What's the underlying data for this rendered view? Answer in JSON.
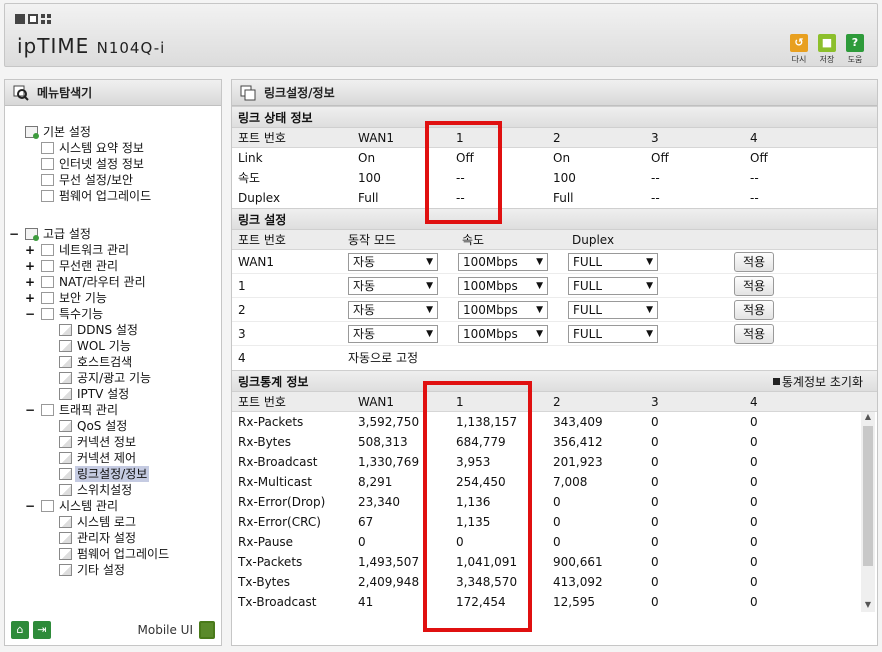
{
  "header": {
    "brand_main": "ipTIME",
    "brand_model": "N104Q-i",
    "buttons": [
      {
        "label": "다시",
        "icon": "undo-icon",
        "color": "#e8a020",
        "glyph": "↺"
      },
      {
        "label": "저장",
        "icon": "save-icon",
        "color": "#8cbf2c",
        "glyph": "■"
      },
      {
        "label": "도움",
        "icon": "help-icon",
        "color": "#2e9b3a",
        "glyph": "?"
      }
    ]
  },
  "sidebar": {
    "title": "메뉴탐색기",
    "basic_group": "기본 설정",
    "basic_items": [
      "시스템 요약 정보",
      "인터넷 설정 정보",
      "무선 설정/보안",
      "펌웨어 업그레이드"
    ],
    "advanced_group": "고급 설정",
    "advanced_items": [
      "네트워크 관리",
      "무선랜 관리",
      "NAT/라우터 관리",
      "보안 기능",
      "특수기능"
    ],
    "special_items": [
      "DDNS 설정",
      "WOL 기능",
      "호스트검색",
      "공지/광고 기능",
      "IPTV 설정"
    ],
    "traffic_group": "트래픽 관리",
    "traffic_items": [
      "QoS 설정",
      "커넥션 정보",
      "커넥션 제어",
      "링크설정/정보",
      "스위치설정"
    ],
    "system_group": "시스템 관리",
    "system_items": [
      "시스템 로그",
      "관리자 설정",
      "펌웨어 업그레이드",
      "기타 설정"
    ],
    "selected": "링크설정/정보",
    "mobile_label": "Mobile UI"
  },
  "main": {
    "title": "링크설정/정보",
    "link_status": {
      "title": "링크 상태 정보",
      "headers": [
        "포트 번호",
        "WAN1",
        "1",
        "2",
        "3",
        "4"
      ],
      "rows": [
        [
          "Link",
          "On",
          "Off",
          "On",
          "Off",
          "Off"
        ],
        [
          "속도",
          "100",
          "--",
          "100",
          "--",
          "--"
        ],
        [
          "Duplex",
          "Full",
          "--",
          "Full",
          "--",
          "--"
        ]
      ]
    },
    "link_config": {
      "title": "링크 설정",
      "headers": [
        "포트 번호",
        "동작 모드",
        "속도",
        "Duplex"
      ],
      "rows": [
        {
          "port": "WAN1",
          "mode": "자동",
          "speed": "100Mbps",
          "duplex": "FULL",
          "apply": "적용"
        },
        {
          "port": "1",
          "mode": "자동",
          "speed": "100Mbps",
          "duplex": "FULL",
          "apply": "적용"
        },
        {
          "port": "2",
          "mode": "자동",
          "speed": "100Mbps",
          "duplex": "FULL",
          "apply": "적용"
        },
        {
          "port": "3",
          "mode": "자동",
          "speed": "100Mbps",
          "duplex": "FULL",
          "apply": "적용"
        }
      ],
      "fixed_row": {
        "port": "4",
        "note": "자동으로 고정"
      }
    },
    "link_stats": {
      "title": "링크통계 정보",
      "reset_label": "통계정보 초기화",
      "headers": [
        "포트 번호",
        "WAN1",
        "1",
        "2",
        "3",
        "4"
      ],
      "rows": [
        [
          "Rx-Packets",
          "3,592,750",
          "1,138,157",
          "343,409",
          "0",
          "0"
        ],
        [
          "Rx-Bytes",
          "508,313",
          "684,779",
          "356,412",
          "0",
          "0"
        ],
        [
          "Rx-Broadcast",
          "1,330,769",
          "3,953",
          "201,923",
          "0",
          "0"
        ],
        [
          "Rx-Multicast",
          "8,291",
          "254,450",
          "7,008",
          "0",
          "0"
        ],
        [
          "Rx-Error(Drop)",
          "23,340",
          "1,136",
          "0",
          "0",
          "0"
        ],
        [
          "Rx-Error(CRC)",
          "67",
          "1,135",
          "0",
          "0",
          "0"
        ],
        [
          "Rx-Pause",
          "0",
          "0",
          "0",
          "0",
          "0"
        ],
        [
          "Tx-Packets",
          "1,493,507",
          "1,041,091",
          "900,661",
          "0",
          "0"
        ],
        [
          "Tx-Bytes",
          "2,409,948",
          "3,348,570",
          "413,092",
          "0",
          "0"
        ],
        [
          "Tx-Broadcast",
          "41",
          "172,454",
          "12,595",
          "0",
          "0"
        ]
      ]
    }
  }
}
